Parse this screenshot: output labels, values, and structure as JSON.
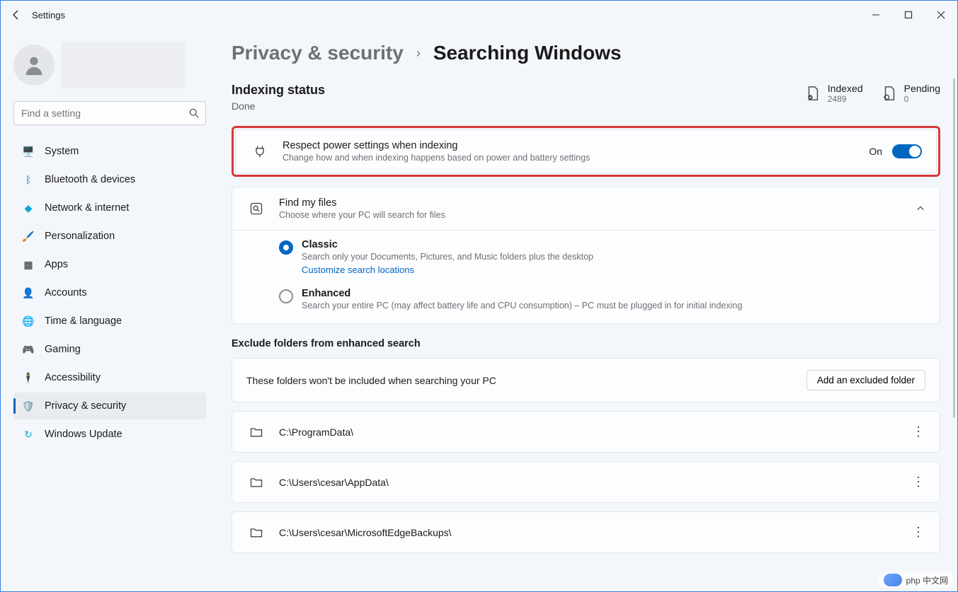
{
  "window": {
    "title": "Settings"
  },
  "search": {
    "placeholder": "Find a setting"
  },
  "sidebar": {
    "items": [
      {
        "label": "System"
      },
      {
        "label": "Bluetooth & devices"
      },
      {
        "label": "Network & internet"
      },
      {
        "label": "Personalization"
      },
      {
        "label": "Apps"
      },
      {
        "label": "Accounts"
      },
      {
        "label": "Time & language"
      },
      {
        "label": "Gaming"
      },
      {
        "label": "Accessibility"
      },
      {
        "label": "Privacy & security"
      },
      {
        "label": "Windows Update"
      }
    ]
  },
  "breadcrumb": {
    "level1": "Privacy & security",
    "level2": "Searching Windows"
  },
  "indexing": {
    "heading": "Indexing status",
    "status": "Done",
    "indexed_label": "Indexed",
    "indexed_value": "2489",
    "pending_label": "Pending",
    "pending_value": "0"
  },
  "power": {
    "title": "Respect power settings when indexing",
    "desc": "Change how and when indexing happens based on power and battery settings",
    "state_label": "On"
  },
  "find": {
    "title": "Find my files",
    "desc": "Choose where your PC will search for files",
    "opt1_label": "Classic",
    "opt1_desc": "Search only your Documents, Pictures, and Music folders plus the desktop",
    "opt1_link": "Customize search locations",
    "opt2_label": "Enhanced",
    "opt2_desc": "Search your entire PC (may affect battery life and CPU consumption) – PC must be plugged in for initial indexing"
  },
  "exclude": {
    "heading": "Exclude folders from enhanced search",
    "intro": "These folders won't be included when searching your PC",
    "add_button": "Add an excluded folder",
    "folders": [
      "C:\\ProgramData\\",
      "C:\\Users\\cesar\\AppData\\",
      "C:\\Users\\cesar\\MicrosoftEdgeBackups\\"
    ]
  },
  "watermark": "php 中文网"
}
